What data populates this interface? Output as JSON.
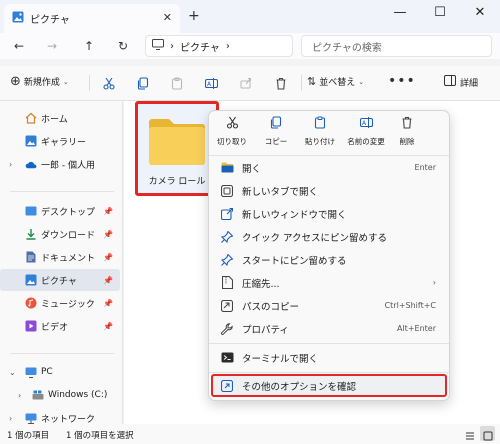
{
  "window": {
    "tab_title": "ピクチャ",
    "new_tab": "+",
    "minimize": "—",
    "maximize": "☐",
    "close": "✕"
  },
  "address_bar": {
    "back": "←",
    "forward": "→",
    "up": "↑",
    "refresh": "↻",
    "path": [
      "ピクチャ"
    ],
    "search_placeholder": "ピクチャの検索"
  },
  "command_bar": {
    "new_label": "新規作成",
    "sort_label": "並べ替え",
    "more": "•••",
    "details_label": "詳細"
  },
  "nav_pane": {
    "items": [
      {
        "label": "ホーム",
        "icon": "home-icon"
      },
      {
        "label": "ギャラリー",
        "icon": "gallery-icon"
      },
      {
        "label": "一郎 - 個人用",
        "icon": "onedrive-icon"
      },
      {
        "label": "デスクトップ",
        "icon": "desktop-icon"
      },
      {
        "label": "ダウンロード",
        "icon": "download-icon"
      },
      {
        "label": "ドキュメント",
        "icon": "document-icon"
      },
      {
        "label": "ピクチャ",
        "icon": "pictures-icon"
      },
      {
        "label": "ミュージック",
        "icon": "music-icon"
      },
      {
        "label": "ビデオ",
        "icon": "video-icon"
      },
      {
        "label": "PC",
        "icon": "pc-icon"
      },
      {
        "label": "Windows (C:)",
        "icon": "drive-icon"
      },
      {
        "label": "ネットワーク",
        "icon": "network-icon"
      }
    ]
  },
  "content": {
    "folder_label": "カメラ ロール"
  },
  "context_menu": {
    "quick_actions": [
      {
        "label": "切り取り",
        "icon": "cut-icon"
      },
      {
        "label": "コピー",
        "icon": "copy-icon"
      },
      {
        "label": "貼り付け",
        "icon": "paste-icon"
      },
      {
        "label": "名前の変更",
        "icon": "rename-icon"
      },
      {
        "label": "削除",
        "icon": "delete-icon"
      }
    ],
    "items": [
      {
        "label": "開く",
        "shortcut": "Enter",
        "icon": "folder-open-icon"
      },
      {
        "label": "新しいタブで開く",
        "shortcut": "",
        "icon": "new-tab-icon"
      },
      {
        "label": "新しいウィンドウで開く",
        "shortcut": "",
        "icon": "new-window-icon"
      },
      {
        "label": "クイック アクセスにピン留めする",
        "shortcut": "",
        "icon": "pin-icon"
      },
      {
        "label": "スタートにピン留めする",
        "shortcut": "",
        "icon": "pin-start-icon"
      },
      {
        "label": "圧縮先...",
        "shortcut": "›",
        "icon": "zip-icon"
      },
      {
        "label": "パスのコピー",
        "shortcut": "Ctrl+Shift+C",
        "icon": "copy-path-icon"
      },
      {
        "label": "プロパティ",
        "shortcut": "Alt+Enter",
        "icon": "properties-icon"
      },
      {
        "label": "ターミナルで開く",
        "shortcut": "",
        "icon": "terminal-icon"
      },
      {
        "label": "その他のオプションを確認",
        "shortcut": "",
        "icon": "more-options-icon"
      }
    ]
  },
  "status_bar": {
    "item_count": "1 個の項目",
    "selected_count": "1 個の項目を選択"
  },
  "colors": {
    "accent": "#1b5fb8",
    "highlight_border": "#e32626",
    "folder": "#f5c84b"
  }
}
